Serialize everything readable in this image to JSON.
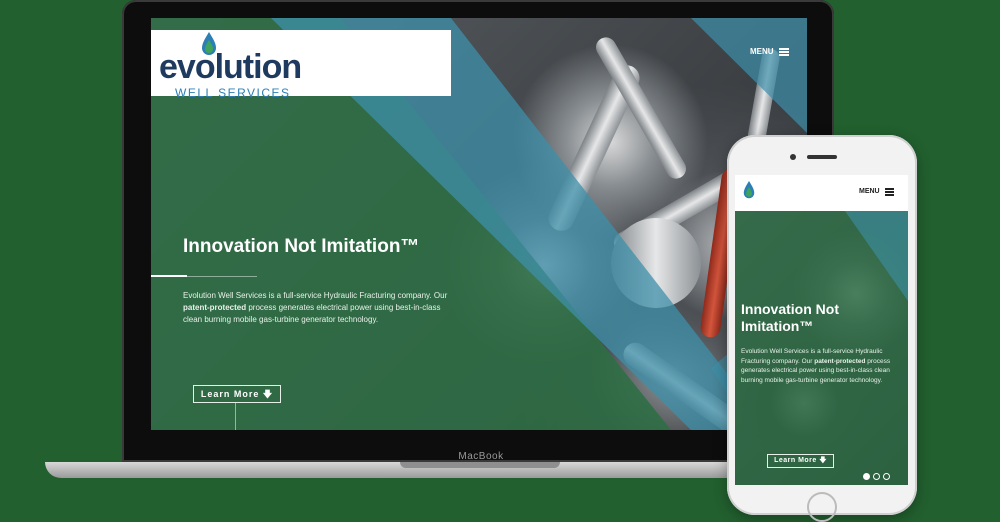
{
  "laptop": {
    "brand_label": "MacBook"
  },
  "site": {
    "logo_word": "evolution",
    "logo_sub": "WELL SERVICES",
    "menu_label": "MENU",
    "hero": {
      "title": "Innovation Not Imitation™",
      "text_before": "Evolution Well Services is a full-service Hydraulic Fracturing company. Our ",
      "text_bold": "patent-protected",
      "text_after": " process generates electrical power using best-in-class clean burning mobile gas-turbine generator technology.",
      "button_label": "Learn More 🡇"
    }
  },
  "phone": {
    "menu_label": "MENU",
    "hero": {
      "title": "Innovation Not Imitation™",
      "text_before": "Evolution Well Services is a full-service Hydraulic Fracturing company. Our ",
      "text_bold": "patent-protected",
      "text_after": " process generates electrical power using best-in-class clean burning mobile gas-turbine generator technology.",
      "button_label": "Learn More 🡇"
    },
    "carousel": {
      "total": 3,
      "active": 1
    }
  },
  "colors": {
    "background": "#22602f",
    "overlay_green": "#2d6e44",
    "overlay_teal": "#3d8fa9",
    "logo_navy": "#1e3a5f",
    "logo_blue": "#2b7fb4"
  }
}
